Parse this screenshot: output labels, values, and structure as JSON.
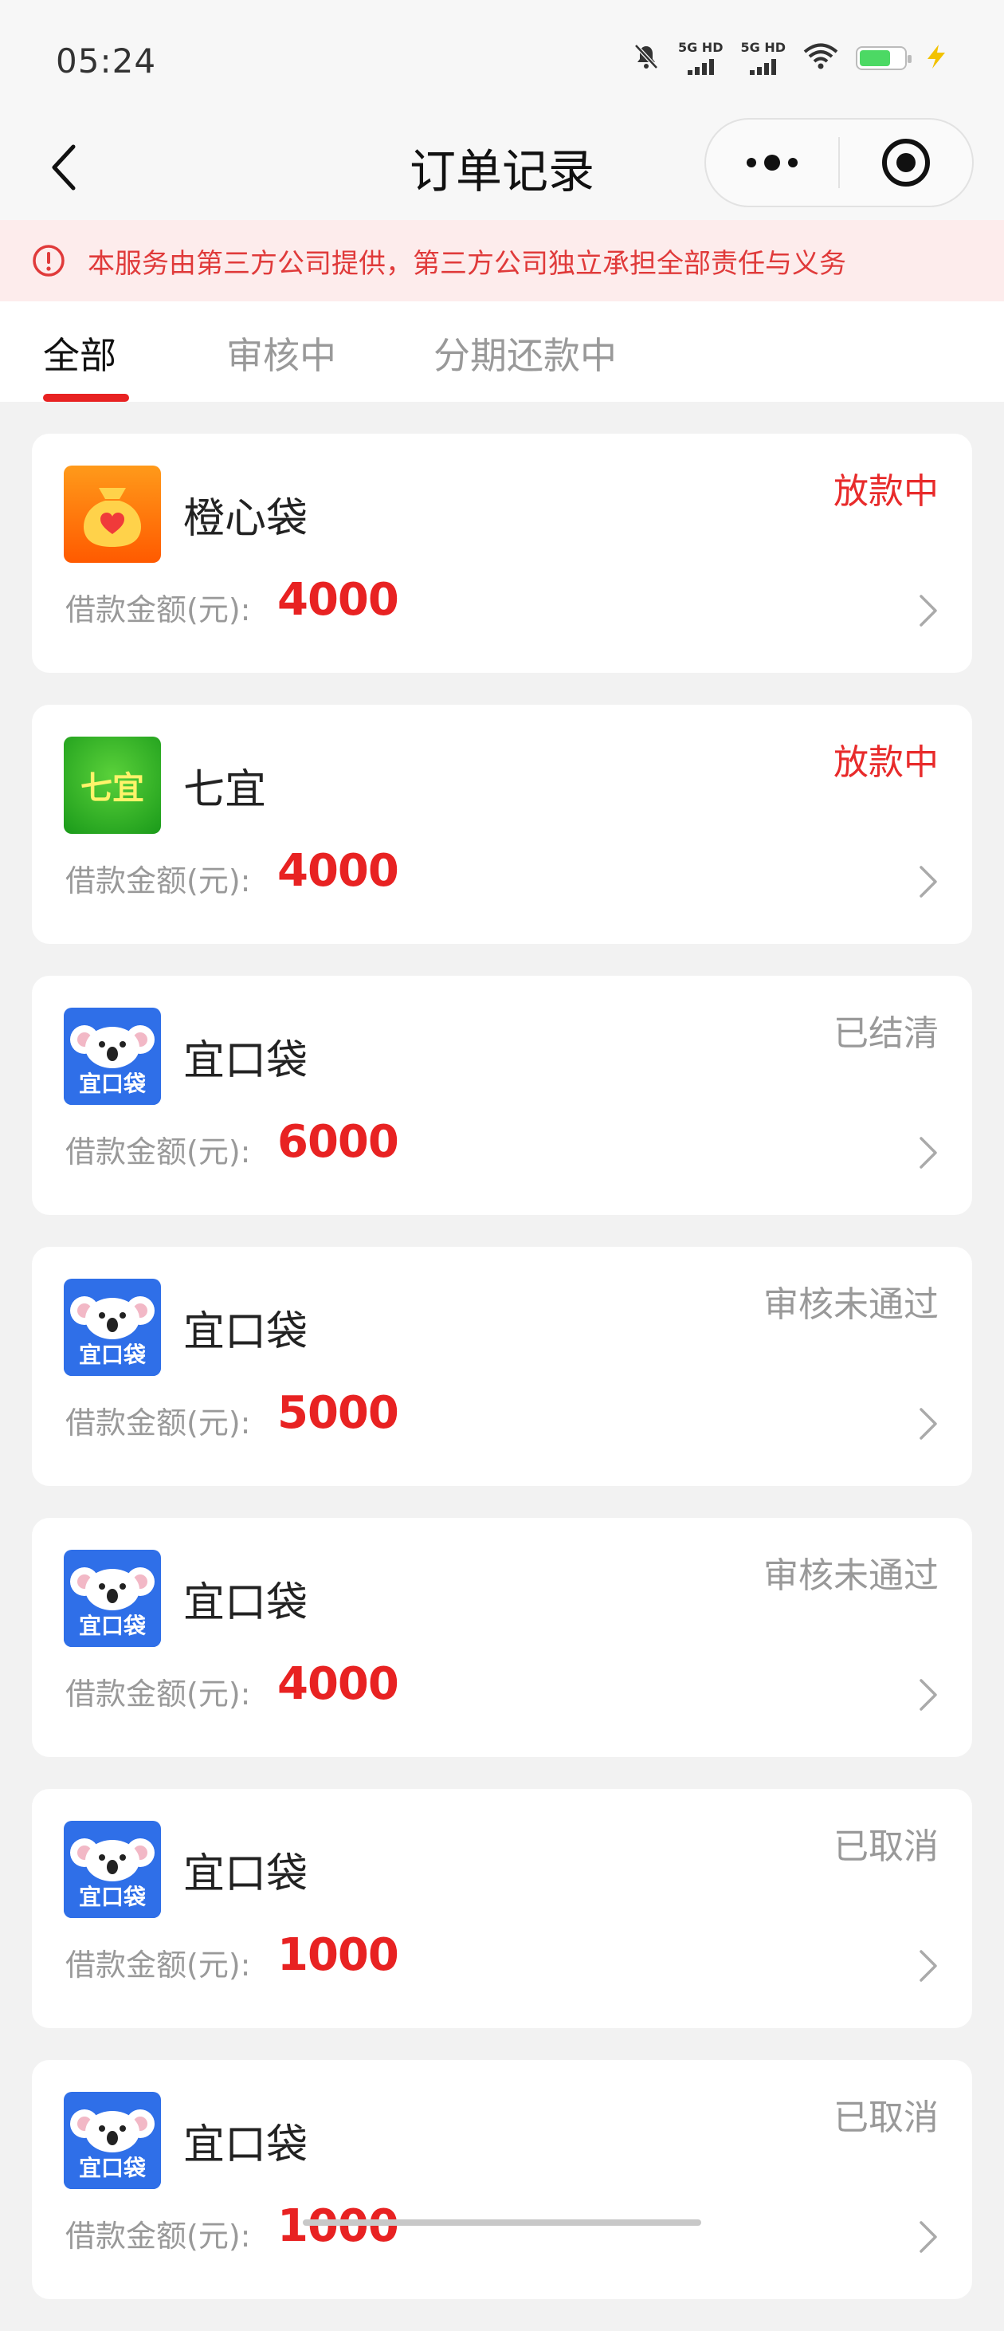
{
  "status_bar": {
    "time": "05:24",
    "signal1_label": "5G HD",
    "signal2_label": "5G HD",
    "icons": [
      "mute-icon",
      "signal-icon",
      "signal-icon",
      "wifi-icon",
      "battery-icon",
      "charging-icon"
    ]
  },
  "nav": {
    "title": "订单记录",
    "back_icon": "back-arrow-icon",
    "more_icon": "more-icon",
    "close_icon": "mini-program-close-icon"
  },
  "notice": {
    "text": "本服务由第三方公司提供，第三方公司独立承担全部责任与义务",
    "color": "#e03a3a"
  },
  "tabs": [
    {
      "label": "全部",
      "active": true
    },
    {
      "label": "审核中",
      "active": false
    },
    {
      "label": "分期还款中",
      "active": false
    }
  ],
  "orders": [
    {
      "name": "橙心袋",
      "status": "放款中",
      "status_color": "#e82b2b",
      "amount_label": "借款金额(元):",
      "amount": "4000",
      "logo": "orange-bag-logo"
    },
    {
      "name": "七宜",
      "status": "放款中",
      "status_color": "#e82b2b",
      "amount_label": "借款金额(元):",
      "amount": "4000",
      "logo": "qiyi-green-logo"
    },
    {
      "name": "宜口袋",
      "status": "已结清",
      "status_color": "#999999",
      "amount_label": "借款金额(元):",
      "amount": "6000",
      "logo": "koala-logo"
    },
    {
      "name": "宜口袋",
      "status": "审核未通过",
      "status_color": "#999999",
      "amount_label": "借款金额(元):",
      "amount": "5000",
      "logo": "koala-logo"
    },
    {
      "name": "宜口袋",
      "status": "审核未通过",
      "status_color": "#999999",
      "amount_label": "借款金额(元):",
      "amount": "4000",
      "logo": "koala-logo"
    },
    {
      "name": "宜口袋",
      "status": "已取消",
      "status_color": "#999999",
      "amount_label": "借款金额(元):",
      "amount": "1000",
      "logo": "koala-logo"
    },
    {
      "name": "宜口袋",
      "status": "已取消",
      "status_color": "#999999",
      "amount_label": "借款金额(元):",
      "amount": "1000",
      "logo": "koala-logo"
    }
  ],
  "logo_text": {
    "qiyi": "七宜",
    "koala": "宜口袋"
  },
  "colors": {
    "accent_red": "#e82222",
    "background": "#f2f2f2"
  }
}
